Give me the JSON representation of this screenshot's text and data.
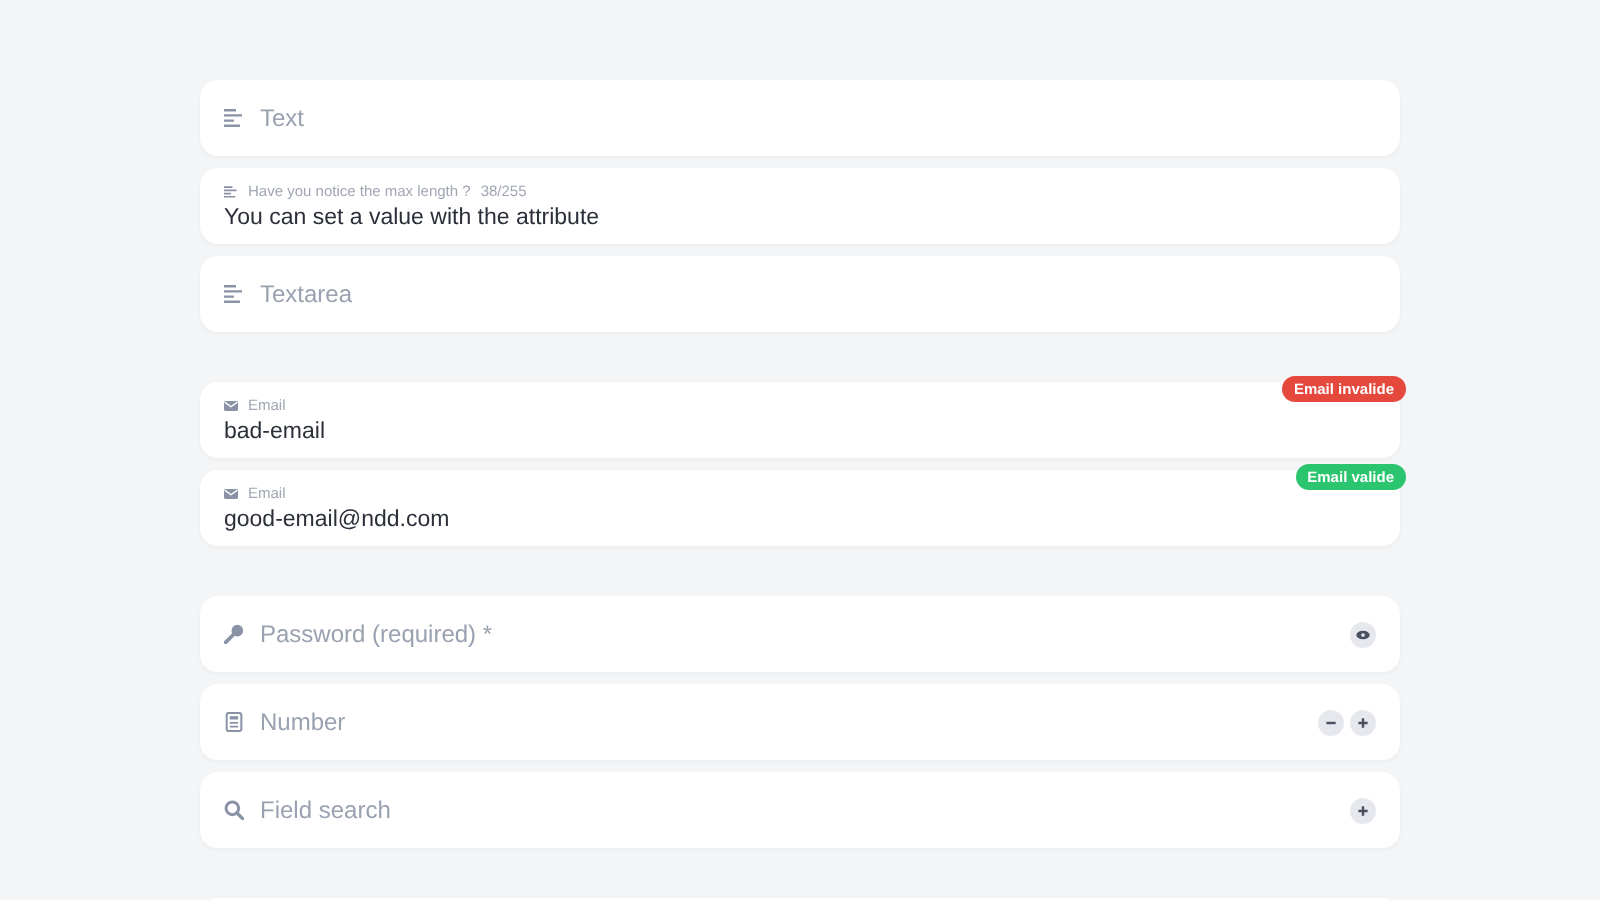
{
  "groups": [
    {
      "fields": [
        {
          "kind": "text",
          "placeholder": "Text"
        },
        {
          "kind": "text",
          "label": "Have you notice the max length ?",
          "counter": "38/255",
          "value": "You can set a value with the attribute"
        },
        {
          "kind": "text",
          "placeholder": "Textarea"
        }
      ]
    },
    {
      "fields": [
        {
          "kind": "email",
          "label": "Email",
          "value": "bad-email",
          "badge": {
            "text": "Email invalide",
            "color": "#e5483d"
          }
        },
        {
          "kind": "email",
          "label": "Email",
          "value": "good-email@ndd.com",
          "badge": {
            "text": "Email valide",
            "color": "#2cc56f"
          }
        }
      ]
    },
    {
      "fields": [
        {
          "kind": "password",
          "placeholder": "Password (required) *"
        },
        {
          "kind": "number",
          "placeholder": "Number"
        },
        {
          "kind": "search",
          "placeholder": "Field search"
        }
      ]
    }
  ]
}
